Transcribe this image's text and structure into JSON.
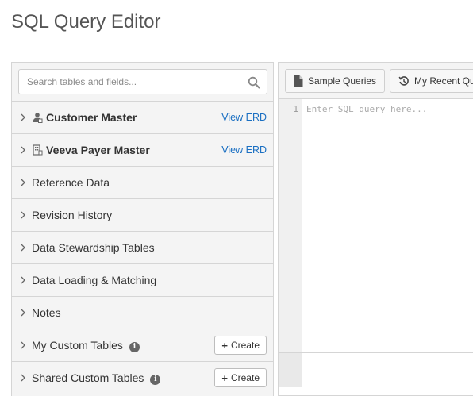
{
  "page": {
    "title": "SQL Query Editor"
  },
  "search": {
    "placeholder": "Search tables and fields..."
  },
  "tree": {
    "items": [
      {
        "label": "Customer Master",
        "icon": "person-icon",
        "link": "View ERD"
      },
      {
        "label": "Veeva Payer Master",
        "icon": "building-icon",
        "link": "View ERD"
      },
      {
        "label": "Reference Data"
      },
      {
        "label": "Revision History"
      },
      {
        "label": "Data Stewardship Tables"
      },
      {
        "label": "Data Loading & Matching"
      },
      {
        "label": "Notes"
      },
      {
        "label": "My Custom Tables",
        "info": "i",
        "action": "Create"
      },
      {
        "label": "Shared Custom Tables",
        "info": "i",
        "action": "Create"
      }
    ]
  },
  "toolbar": {
    "sample_queries": "Sample Queries",
    "recent_queries": "My Recent Queries"
  },
  "editor": {
    "line_number": "1",
    "placeholder": "Enter SQL query here..."
  },
  "colors": {
    "accent_rule": "#d6b84a",
    "link": "#1a6fc2"
  }
}
